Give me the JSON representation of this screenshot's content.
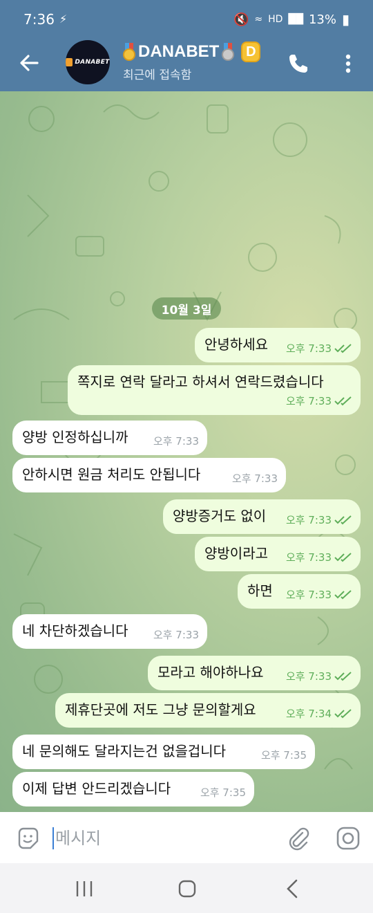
{
  "status_bar": {
    "time": "7:36",
    "battery": "13%",
    "left_icon": "usb-icon",
    "right_icons": [
      "mute-icon",
      "wifi-icon",
      "hd-voice-icon",
      "signal-icon",
      "battery-icon"
    ]
  },
  "header": {
    "title": "DANABET",
    "subtitle": "최근에 접속함",
    "avatar_logo": "DANABET",
    "badge_letter": "D",
    "icons": [
      "back-arrow-icon",
      "gold-medal-icon",
      "silver-medal-icon",
      "phone-icon",
      "more-vertical-icon"
    ]
  },
  "colors": {
    "header": "#527da3",
    "outgoing_bubble": "#effdde",
    "incoming_bubble": "#ffffff",
    "tick": "#5fae5a",
    "date_pill": "#6b9a5a"
  },
  "chat": {
    "date_label": "10월 3일",
    "messages": [
      {
        "dir": "out",
        "text": "안녕하세요",
        "time": "오후 7:33",
        "read": true
      },
      {
        "dir": "out",
        "text": "쪽지로 연락 달라고 하셔서 연락드렸습니다",
        "time": "오후 7:33",
        "read": true
      },
      {
        "dir": "in",
        "text": "양방 인정하십니까",
        "time": "오후 7:33"
      },
      {
        "dir": "in",
        "text": "안하시면 원금 처리도 안됩니다",
        "time": "오후 7:33"
      },
      {
        "dir": "out",
        "text": "양방증거도 없이",
        "time": "오후 7:33",
        "read": true
      },
      {
        "dir": "out",
        "text": "양방이라고",
        "time": "오후 7:33",
        "read": true
      },
      {
        "dir": "out",
        "text": "하면",
        "time": "오후 7:33",
        "read": true
      },
      {
        "dir": "in",
        "text": "네 차단하겠습니다",
        "time": "오후 7:33"
      },
      {
        "dir": "out",
        "text": "모라고 해야하나요",
        "time": "오후 7:33",
        "read": true
      },
      {
        "dir": "out",
        "text": "제휴단곳에 저도 그냥 문의할게요",
        "time": "오후 7:34",
        "read": true
      },
      {
        "dir": "in",
        "text": "네 문의해도 달라지는건 없을겁니다",
        "time": "오후 7:35"
      },
      {
        "dir": "in",
        "text": "이제 답변 안드리겠습니다",
        "time": "오후 7:35"
      }
    ]
  },
  "composer": {
    "placeholder": "메시지",
    "icons": [
      "sticker-icon",
      "attach-icon",
      "camera-icon"
    ]
  },
  "nav_bar": {
    "icons": [
      "recents-icon",
      "home-icon",
      "back-icon"
    ]
  }
}
